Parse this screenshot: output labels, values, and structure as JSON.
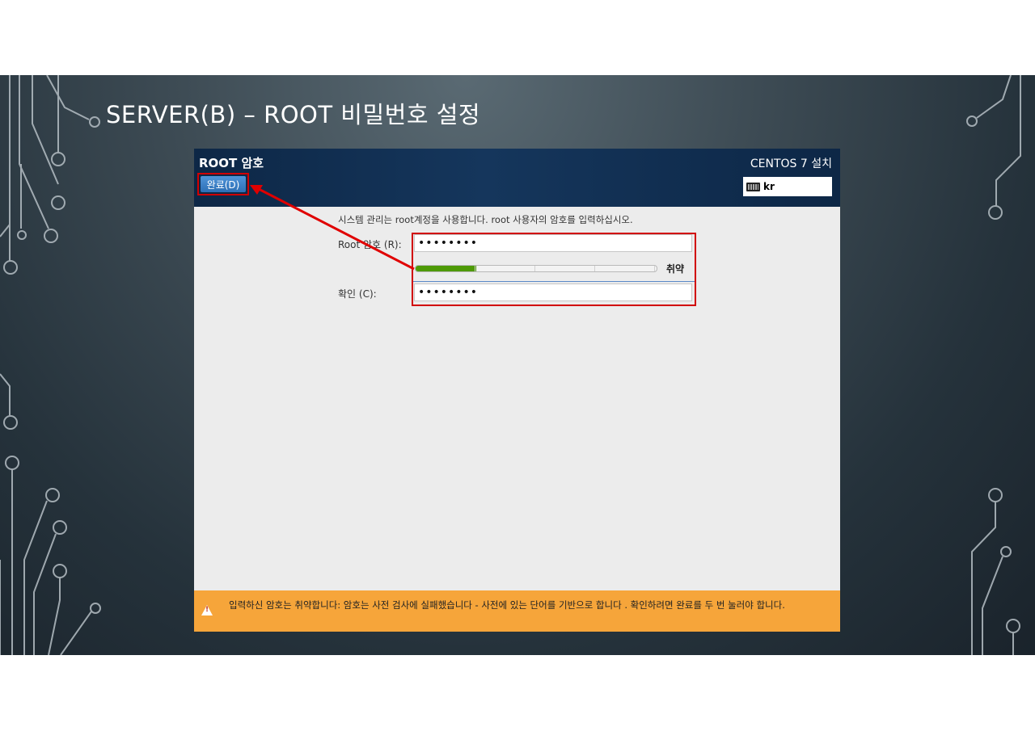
{
  "slide": {
    "title": "SERVER(B) – ROOT 비밀번호 설정"
  },
  "window": {
    "header_title": "ROOT 암호",
    "done_button": "완료(D)",
    "product": "CENTOS 7 설치",
    "keyboard_layout": "kr"
  },
  "form": {
    "intro": "시스템 관리는 root계정을 사용합니다. root 사용자의 암호를 입력하십시오.",
    "root_label": "Root 암호 (R):",
    "root_value": "••••••••",
    "strength_label": "취약",
    "strength_fraction": 0.25,
    "confirm_label": "확인 (C):",
    "confirm_value": "••••••••"
  },
  "warning": {
    "text": "입력하신 암호는 취약합니다: 암호는 사전 검사에 실패했습니다  - 사전에 있는 단어를 기반으로 합니다 . 확인하려면 완료를 두 번 눌러야 합니다."
  },
  "colors": {
    "header": "#15365c",
    "done_button": "#3b82c9",
    "highlight": "#d10000",
    "strength": "#4e9a06",
    "warning_bar": "#f6a53a"
  }
}
